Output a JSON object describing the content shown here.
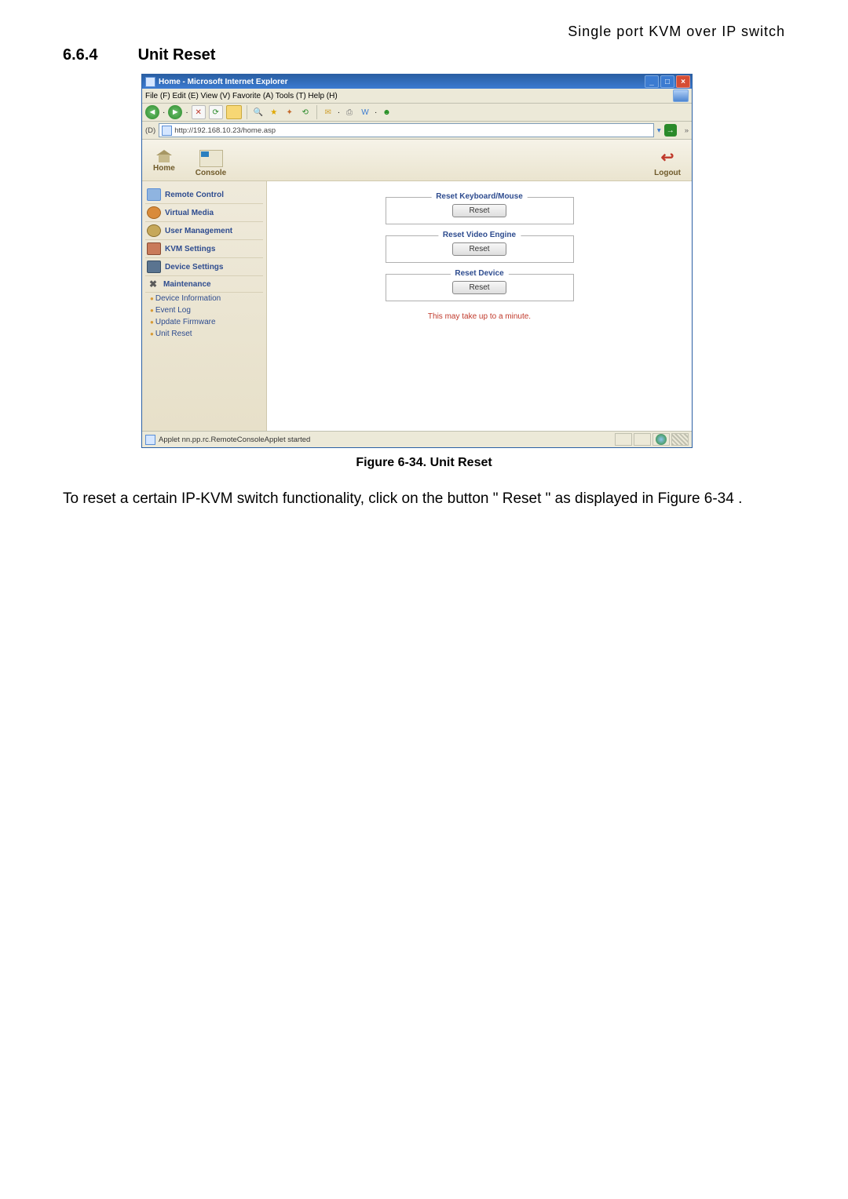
{
  "doc": {
    "header_right": "Single port KVM over IP switch",
    "section_number": "6.6.4",
    "section_title": "Unit Reset",
    "figure_caption": "Figure 6-34. Unit Reset",
    "body_text": "To reset a certain IP-KVM switch functionality, click on the button \" Reset \" as displayed in Figure 6-34 ."
  },
  "window": {
    "title": "Home - Microsoft Internet Explorer",
    "menubar": "File (F)  Edit (E)  View (V)  Favorite (A)  Tools (T)  Help (H)",
    "address_label": "(D)",
    "url": "http://192.168.10.23/home.asp",
    "status_text": "Applet nn.pp.rc.RemoteConsoleApplet started"
  },
  "topbar": {
    "home": "Home",
    "console": "Console",
    "logout": "Logout"
  },
  "sidebar": {
    "remote_control": "Remote Control",
    "virtual_media": "Virtual Media",
    "user_management": "User Management",
    "kvm_settings": "KVM Settings",
    "device_settings": "Device Settings",
    "maintenance": "Maintenance",
    "sub": {
      "device_info": "Device Information",
      "event_log": "Event Log",
      "update_firmware": "Update Firmware",
      "unit_reset": "Unit Reset"
    }
  },
  "panels": {
    "kbd_mouse_legend": "Reset Keyboard/Mouse",
    "video_legend": "Reset Video Engine",
    "device_legend": "Reset Device",
    "reset_btn": "Reset",
    "warn": "This may take up to a minute."
  }
}
